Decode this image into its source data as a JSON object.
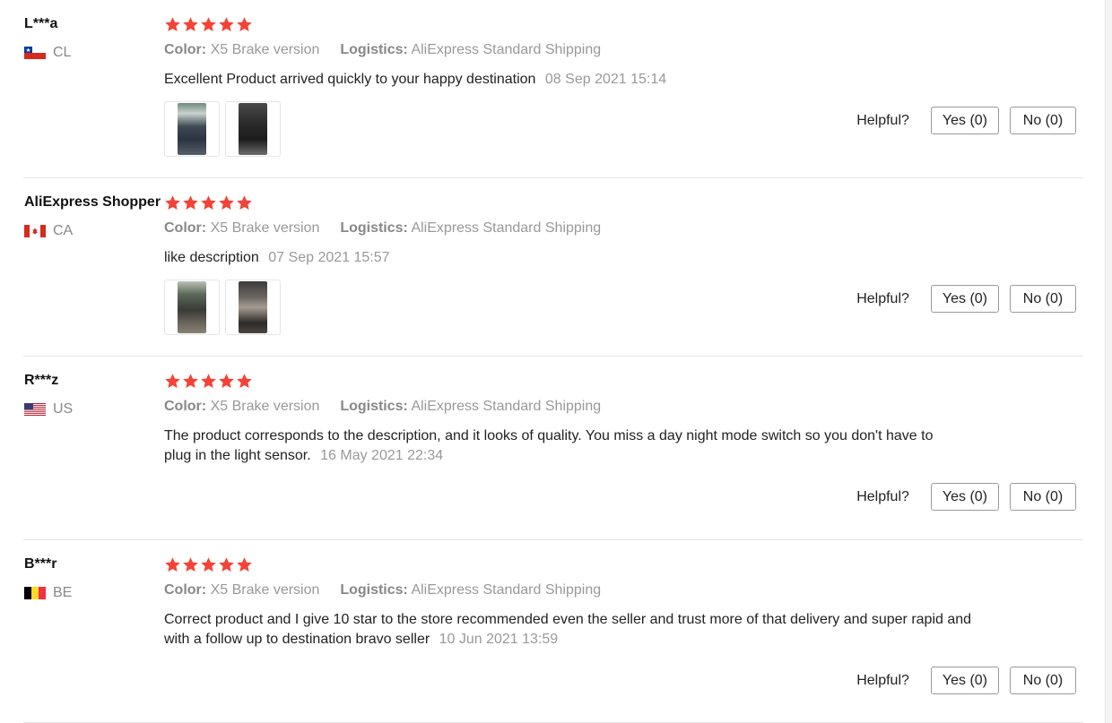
{
  "labels": {
    "color_key": "Color:",
    "logistics_key": "Logistics:",
    "helpful": "Helpful?",
    "yes": "Yes (0)",
    "no": "No (0)"
  },
  "colors": {
    "star": "#f44336",
    "meta_key": "#888888",
    "date": "#999999"
  },
  "reviews": [
    {
      "user": "L***a",
      "country": "CL",
      "flag": "chile-flag-icon",
      "stars": 5,
      "color": "X5 Brake version",
      "logistics": "AliExpress Standard Shipping",
      "text": "Excellent Product arrived quickly to your happy destination",
      "date": "08 Sep 2021 15:14",
      "photos": 2
    },
    {
      "user": "AliExpress Shopper",
      "country": "CA",
      "flag": "canada-flag-icon",
      "stars": 5,
      "color": "X5 Brake version",
      "logistics": "AliExpress Standard Shipping",
      "text": "like description",
      "date": "07 Sep 2021 15:57",
      "photos": 2
    },
    {
      "user": "R***z",
      "country": "US",
      "flag": "usa-flag-icon",
      "stars": 5,
      "color": "X5 Brake version",
      "logistics": "AliExpress Standard Shipping",
      "text": "The product corresponds to the description, and it looks of quality. You miss a day night mode switch so you don't have to plug in the light sensor.",
      "date": "16 May 2021 22:34",
      "photos": 0
    },
    {
      "user": "B***r",
      "country": "BE",
      "flag": "belgium-flag-icon",
      "stars": 5,
      "color": "X5 Brake version",
      "logistics": "AliExpress Standard Shipping",
      "text": "Correct product and I give 10 star to the store recommended even the seller and trust more of that delivery and super rapid and with a follow up to destination bravo seller",
      "date": "10 Jun 2021 13:59",
      "photos": 0
    }
  ]
}
